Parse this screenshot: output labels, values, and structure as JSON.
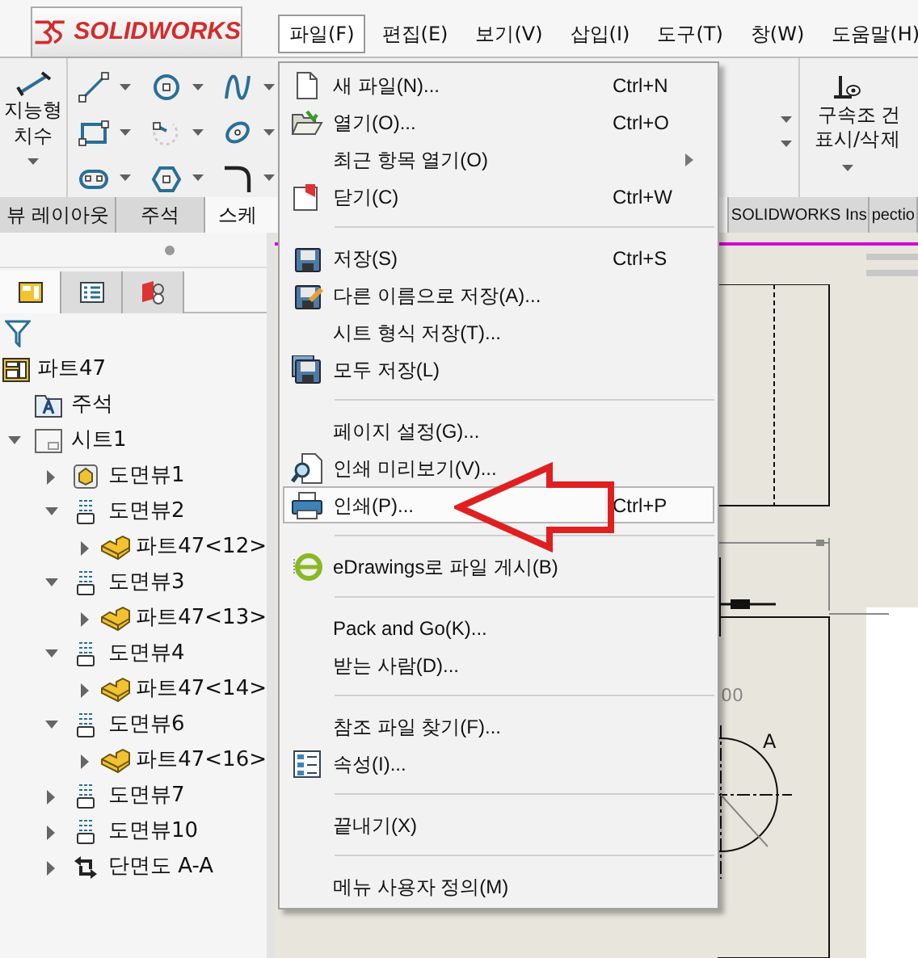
{
  "logo": "SOLIDWORKS",
  "menubar": [
    {
      "label": "파일(F)",
      "selected": true
    },
    {
      "label": "편집(E)",
      "selected": false
    },
    {
      "label": "보기(V)",
      "selected": false
    },
    {
      "label": "삽입(I)",
      "selected": false
    },
    {
      "label": "도구(T)",
      "selected": false
    },
    {
      "label": "창(W)",
      "selected": false
    },
    {
      "label": "도움말(H)",
      "selected": false
    }
  ],
  "toolbar": {
    "smart_dimension": [
      "지능형",
      "치수"
    ],
    "relations": [
      "구속조",
      "표시/삭"
    ],
    "relations_overlap": [
      "건",
      "제"
    ]
  },
  "tabs": [
    {
      "label": "뷰 레이아웃",
      "selected": false
    },
    {
      "label": "주석",
      "selected": false
    },
    {
      "label": "스케",
      "selected": true
    },
    {
      "label": "SOLIDWORKS Ins",
      "selected": false
    },
    {
      "label": "pectio",
      "selected": false
    }
  ],
  "panel_tabs": [
    {
      "kind": "tree",
      "selected": true
    },
    {
      "kind": "properties",
      "selected": false
    },
    {
      "kind": "display",
      "selected": false
    }
  ],
  "tree": {
    "label": "파트47",
    "kind": "drawing",
    "children": [
      {
        "label": "주석",
        "kind": "annotation"
      },
      {
        "label": "시트1",
        "kind": "sheet",
        "expanded": true,
        "children": [
          {
            "label": "도면뷰1",
            "kind": "view1",
            "expanded": false
          },
          {
            "label": "도면뷰2",
            "kind": "view",
            "expanded": true,
            "children": [
              {
                "label": "파트47<12>",
                "kind": "part",
                "expanded": false
              }
            ]
          },
          {
            "label": "도면뷰3",
            "kind": "view",
            "expanded": true,
            "children": [
              {
                "label": "파트47<13>",
                "kind": "part",
                "expanded": false
              }
            ]
          },
          {
            "label": "도면뷰4",
            "kind": "view",
            "expanded": true,
            "children": [
              {
                "label": "파트47<14>",
                "kind": "part",
                "expanded": false
              }
            ]
          },
          {
            "label": "도면뷰6",
            "kind": "view",
            "expanded": true,
            "children": [
              {
                "label": "파트47<16>",
                "kind": "part",
                "expanded": false
              }
            ]
          },
          {
            "label": "도면뷰7",
            "kind": "view",
            "expanded": false
          },
          {
            "label": "도면뷰10",
            "kind": "view",
            "expanded": false
          },
          {
            "label": "단면도 A-A",
            "kind": "section",
            "expanded": false
          }
        ]
      }
    ]
  },
  "menu": [
    [
      {
        "kind": "new",
        "label": "새 파일(N)...",
        "shortcut": "Ctrl+N",
        "selected": false
      },
      {
        "kind": "open",
        "label": "열기(O)...",
        "shortcut": "Ctrl+O",
        "selected": false
      },
      {
        "kind": "plain",
        "label": "최근 항목 열기(O)",
        "submenu": true,
        "selected": false
      },
      {
        "kind": "close",
        "label": "닫기(C)",
        "shortcut": "Ctrl+W",
        "selected": false
      }
    ],
    [
      {
        "kind": "save",
        "label": "저장(S)",
        "shortcut": "Ctrl+S",
        "selected": false
      },
      {
        "kind": "saveas",
        "label": "다른 이름으로 저장(A)...",
        "selected": false
      },
      {
        "kind": "plain",
        "label": "시트 형식 저장(T)...",
        "selected": false
      },
      {
        "kind": "saveall",
        "label": "모두 저장(L)",
        "selected": false
      }
    ],
    [
      {
        "kind": "plain",
        "label": "페이지 설정(G)...",
        "selected": false
      },
      {
        "kind": "preview",
        "label": "인쇄 미리보기(V)...",
        "selected": false
      },
      {
        "kind": "print",
        "label": "인쇄(P)...",
        "shortcut": "Ctrl+P",
        "selected": true
      }
    ],
    [
      {
        "kind": "edrawings",
        "label": "eDrawings로 파일 게시(B)",
        "selected": false
      }
    ],
    [
      {
        "kind": "plain",
        "label": "Pack and Go(K)...",
        "selected": false
      },
      {
        "kind": "plain",
        "label": "받는 사람(D)...",
        "selected": false
      }
    ],
    [
      {
        "kind": "plain",
        "label": "참조 파일 찾기(F)...",
        "selected": false
      },
      {
        "kind": "properties",
        "label": "속성(I)...",
        "selected": false
      }
    ],
    [
      {
        "kind": "plain",
        "label": "끝내기(X)",
        "selected": false
      }
    ],
    [
      {
        "kind": "plain",
        "label": "메뉴 사용자 정의(M)",
        "selected": false
      }
    ]
  ],
  "drawing": {
    "dimension": "00",
    "section_label": "A"
  }
}
